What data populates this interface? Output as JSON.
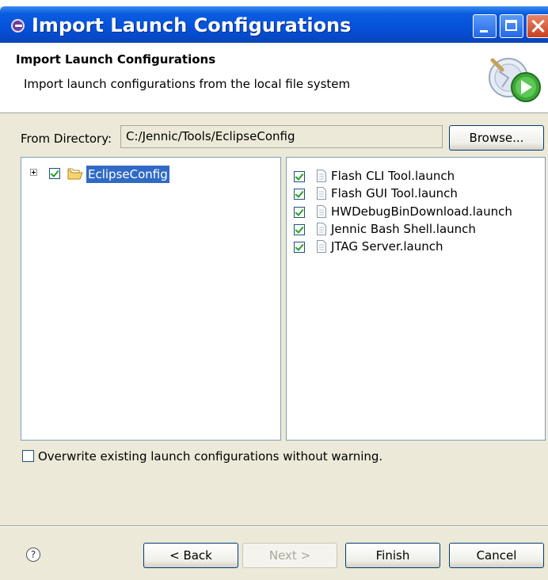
{
  "window": {
    "title": "Import Launch Configurations"
  },
  "header": {
    "title": "Import Launch Configurations",
    "description": "Import launch configurations from the local file system"
  },
  "directory": {
    "label": "From Directory:",
    "value": "C:/Jennic/Tools/EclipseConfig",
    "browse_label": "Browse..."
  },
  "tree": {
    "items": [
      {
        "label": "EclipseConfig",
        "checked": true,
        "selected": true,
        "icon": "folder-open-icon"
      }
    ]
  },
  "files": {
    "items": [
      {
        "label": "Flash CLI Tool.launch",
        "checked": true
      },
      {
        "label": "Flash GUI Tool.launch",
        "checked": true
      },
      {
        "label": "HWDebugBinDownload.launch",
        "checked": true
      },
      {
        "label": "Jennic Bash Shell.launch",
        "checked": true
      },
      {
        "label": "JTAG Server.launch",
        "checked": true
      }
    ]
  },
  "options": {
    "overwrite_label": "Overwrite existing launch configurations without warning.",
    "overwrite_checked": false
  },
  "buttons": {
    "help": "?",
    "back": "< Back",
    "next": "Next >",
    "finish": "Finish",
    "cancel": "Cancel"
  },
  "colors": {
    "titlebar": "#0551d8",
    "selection": "#316ac5",
    "dialog_bg": "#ece9d8"
  }
}
